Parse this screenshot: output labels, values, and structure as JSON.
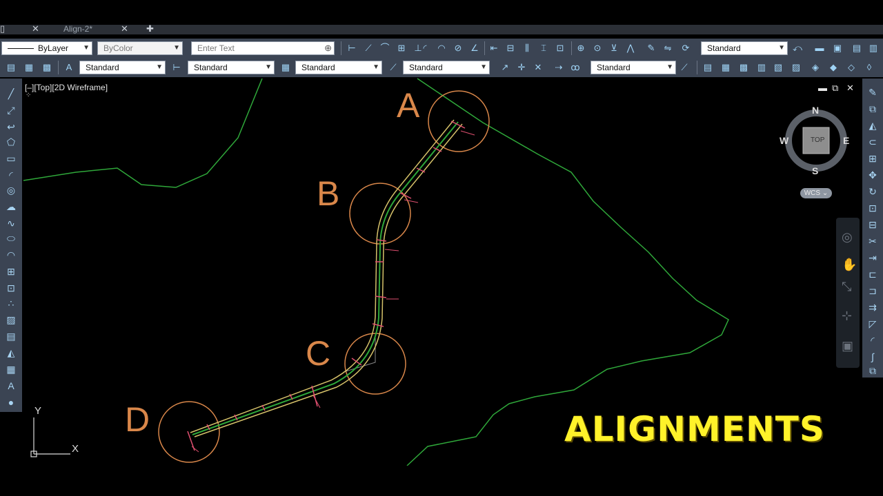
{
  "tabs": [
    {
      "label": "Align-2*"
    }
  ],
  "toolbar1": {
    "linetype": "ByLayer",
    "color": "ByColor",
    "search_placeholder": "Enter Text",
    "style_right": "Standard"
  },
  "toolbar2": {
    "text_style": "Standard",
    "dim_style": "Standard",
    "table_style": "Standard",
    "mleader_style": "Standard",
    "style5": "Standard"
  },
  "viewport": {
    "label": "[–][Top][2D Wireframe]",
    "title_overlay": "ALIGNMENTS",
    "points": [
      "A",
      "B",
      "C",
      "D"
    ]
  },
  "viewcube": {
    "face": "TOP",
    "north": "N",
    "south": "S",
    "east": "E",
    "west": "W",
    "ucs": "WCS"
  },
  "ucs_icon": {
    "x": "X",
    "y": "Y"
  },
  "colors": {
    "background": "#000000",
    "ribbon": "#3b4453",
    "contour": "#2fa83a",
    "alignment": "#d6c26a",
    "circle": "#d9874a",
    "overlay_text": "#fff22a"
  }
}
